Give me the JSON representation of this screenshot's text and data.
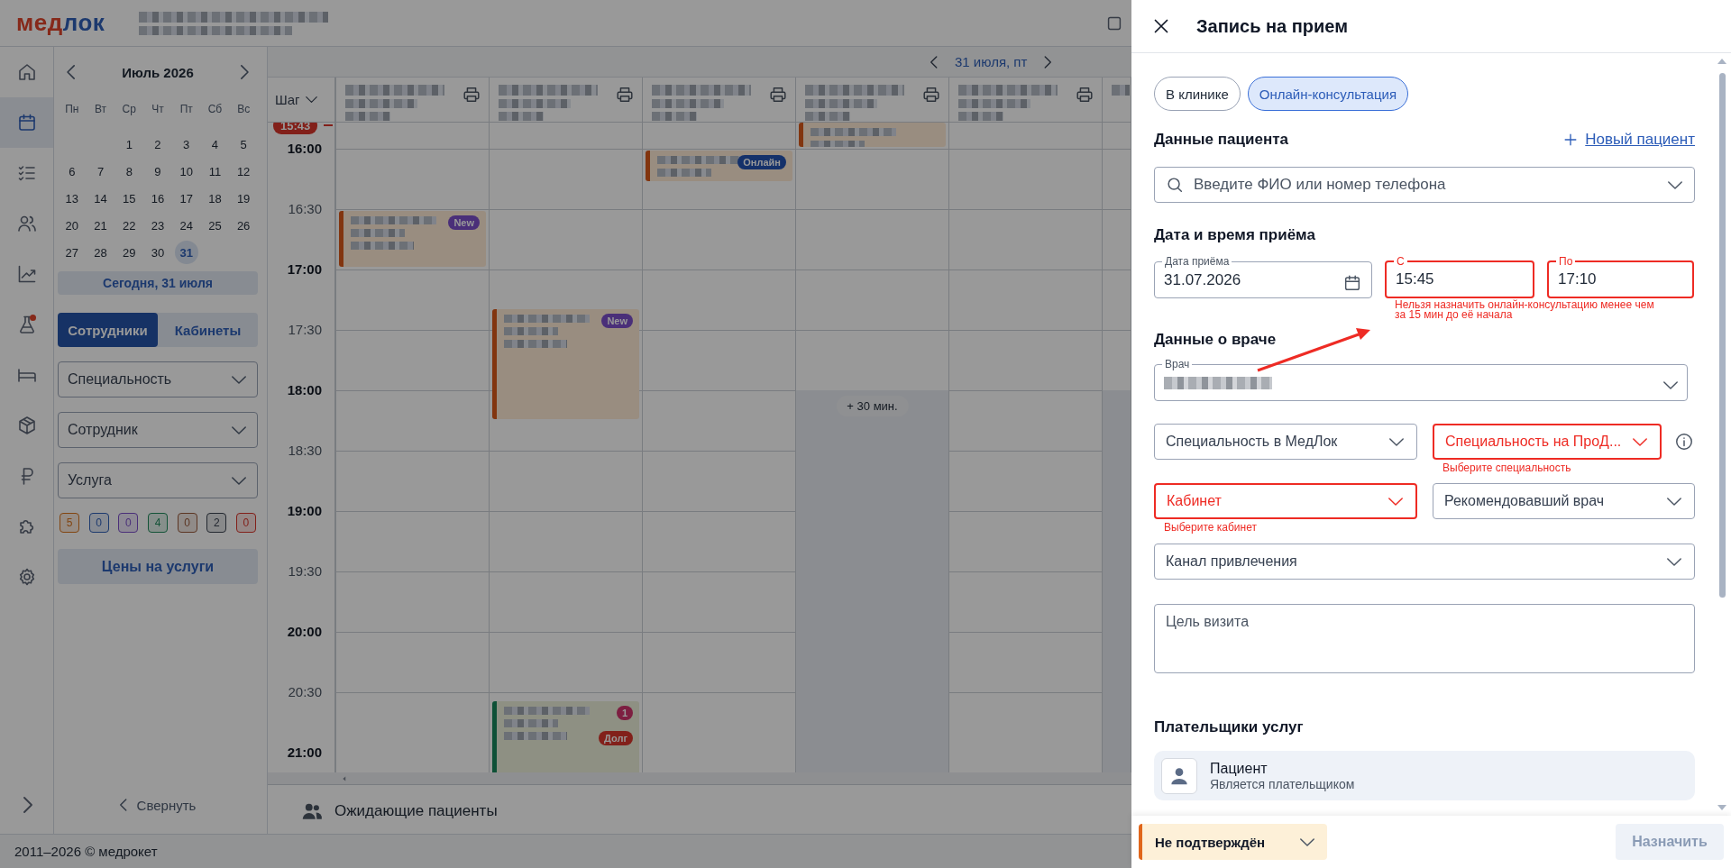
{
  "header": {
    "logo_red": "мед",
    "logo_blue": "лок"
  },
  "rail": {
    "items": [
      {
        "kind": "home",
        "selected": false,
        "dot": false
      },
      {
        "kind": "calendar",
        "selected": true,
        "dot": false
      },
      {
        "kind": "tasks",
        "selected": false,
        "dot": false
      },
      {
        "kind": "people",
        "selected": false,
        "dot": false
      },
      {
        "kind": "chart",
        "selected": false,
        "dot": false
      },
      {
        "kind": "flask",
        "selected": false,
        "dot": true
      },
      {
        "kind": "bed",
        "selected": false,
        "dot": false
      },
      {
        "kind": "box",
        "selected": false,
        "dot": false
      },
      {
        "kind": "ruble",
        "selected": false,
        "dot": false
      },
      {
        "kind": "puzzle",
        "selected": false,
        "dot": false
      },
      {
        "kind": "gear",
        "selected": false,
        "dot": false
      }
    ]
  },
  "calendar": {
    "month": "Июль 2026",
    "weekdays": [
      "Пн",
      "Вт",
      "Ср",
      "Чт",
      "Пт",
      "Сб",
      "Вс"
    ],
    "weeks": [
      {
        "days": [
          {
            "kind": "blank"
          },
          {
            "kind": "blank"
          },
          {
            "kind": "day",
            "day": "1",
            "selected": false
          },
          {
            "kind": "day",
            "day": "2",
            "selected": false
          },
          {
            "kind": "day",
            "day": "3",
            "selected": false
          },
          {
            "kind": "day",
            "day": "4",
            "selected": false
          },
          {
            "kind": "day",
            "day": "5",
            "selected": false
          }
        ]
      },
      {
        "days": [
          {
            "kind": "day",
            "day": "6",
            "selected": false
          },
          {
            "kind": "day",
            "day": "7",
            "selected": false
          },
          {
            "kind": "day",
            "day": "8",
            "selected": false
          },
          {
            "kind": "day",
            "day": "9",
            "selected": false
          },
          {
            "kind": "day",
            "day": "10",
            "selected": false
          },
          {
            "kind": "day",
            "day": "11",
            "selected": false
          },
          {
            "kind": "day",
            "day": "12",
            "selected": false
          }
        ]
      },
      {
        "days": [
          {
            "kind": "day",
            "day": "13",
            "selected": false
          },
          {
            "kind": "day",
            "day": "14",
            "selected": false
          },
          {
            "kind": "day",
            "day": "15",
            "selected": false
          },
          {
            "kind": "day",
            "day": "16",
            "selected": false
          },
          {
            "kind": "day",
            "day": "17",
            "selected": false
          },
          {
            "kind": "day",
            "day": "18",
            "selected": false
          },
          {
            "kind": "day",
            "day": "19",
            "selected": false
          }
        ]
      },
      {
        "days": [
          {
            "kind": "day",
            "day": "20",
            "selected": false
          },
          {
            "kind": "day",
            "day": "21",
            "selected": false
          },
          {
            "kind": "day",
            "day": "22",
            "selected": false
          },
          {
            "kind": "day",
            "day": "23",
            "selected": false
          },
          {
            "kind": "day",
            "day": "24",
            "selected": false
          },
          {
            "kind": "day",
            "day": "25",
            "selected": false
          },
          {
            "kind": "day",
            "day": "26",
            "selected": false
          }
        ]
      },
      {
        "days": [
          {
            "kind": "day",
            "day": "27",
            "selected": false
          },
          {
            "kind": "day",
            "day": "28",
            "selected": false
          },
          {
            "kind": "day",
            "day": "29",
            "selected": false
          },
          {
            "kind": "day",
            "day": "30",
            "selected": false
          },
          {
            "kind": "day",
            "day": "31",
            "selected": true
          }
        ]
      }
    ],
    "today_button": "Сегодня, 31 июля"
  },
  "side": {
    "view_tabs": [
      {
        "label": "Сотрудники",
        "selected": true
      },
      {
        "label": "Кабинеты",
        "selected": false
      }
    ],
    "filters": [
      {
        "placeholder": "Специальность"
      },
      {
        "placeholder": "Сотрудник"
      },
      {
        "placeholder": "Услуга"
      }
    ],
    "counters": [
      {
        "value": "5",
        "color": "#824510"
      },
      {
        "value": "0",
        "color": "#1c396e"
      },
      {
        "value": "0",
        "color": "#4a2f79"
      },
      {
        "value": "4",
        "color": "#135337"
      },
      {
        "value": "0",
        "color": "#5c3623"
      },
      {
        "value": "2",
        "color": "#232830"
      },
      {
        "value": "0",
        "color": "#82201a"
      }
    ],
    "prices_button": "Цены на услуги",
    "collapse": "Свернуть"
  },
  "schedule": {
    "date": "31 июля, пт",
    "step": "Шаг",
    "current_time": "15:43",
    "times": [
      {
        "label": "16:00",
        "emphasized": true
      },
      {
        "label": "16:30",
        "emphasized": false
      },
      {
        "label": "17:00",
        "emphasized": true
      },
      {
        "label": "17:30",
        "emphasized": false
      },
      {
        "label": "18:00",
        "emphasized": true
      },
      {
        "label": "18:30",
        "emphasized": false
      },
      {
        "label": "19:00",
        "emphasized": true
      },
      {
        "label": "19:30",
        "emphasized": false
      },
      {
        "label": "20:00",
        "emphasized": true
      },
      {
        "label": "20:30",
        "emphasized": false
      },
      {
        "label": "21:00",
        "emphasized": true
      }
    ],
    "columns": [
      {
        "cut_off": false,
        "slots": [
          {
            "kind": "free"
          },
          {
            "kind": "free"
          },
          {
            "kind": "normal",
            "color": "#82350f",
            "badges": [
              {
                "label": "New",
                "color": "#4a2f79"
              }
            ]
          }
        ]
      },
      {
        "cut_off": false,
        "slots": [
          {
            "kind": "free"
          },
          {
            "kind": "free"
          },
          {
            "kind": "free"
          },
          {
            "kind": "long",
            "color": "#82350f",
            "badges": [
              {
                "label": "New",
                "color": "#4a2f79"
              }
            ]
          },
          {
            "kind": "free"
          },
          {
            "kind": "free"
          },
          {
            "kind": "free"
          },
          {
            "kind": "free"
          },
          {
            "kind": "free"
          },
          {
            "kind": "free"
          },
          {
            "kind": "open",
            "color": "#0e5036",
            "badges": [
              {
                "label": "1",
                "color": "#7d1f41"
              },
              {
                "label": "Долг",
                "color": "#82201a"
              }
            ]
          }
        ]
      },
      {
        "cut_off": false,
        "slots": [
          {
            "kind": "free"
          },
          {
            "kind": "short",
            "color": "#82350f",
            "badges": [
              {
                "label": "Онлайн",
                "color": "#15316a"
              }
            ]
          }
        ]
      },
      {
        "cut_off": false,
        "slots": [
          {
            "kind": "tail",
            "color": "#82350f"
          },
          {
            "kind": "free"
          },
          {
            "kind": "free"
          },
          {
            "kind": "free"
          },
          {
            "kind": "free"
          },
          {
            "kind": "blocked",
            "extra_label": "+ 30 мин."
          },
          {
            "kind": "blocked"
          },
          {
            "kind": "blocked"
          },
          {
            "kind": "blocked"
          },
          {
            "kind": "blocked"
          },
          {
            "kind": "blocked"
          },
          {
            "kind": "blocked"
          }
        ]
      },
      {
        "cut_off": false
      },
      {
        "cut_off": true,
        "slots": [
          {
            "kind": "free"
          },
          {
            "kind": "free"
          },
          {
            "kind": "free"
          },
          {
            "kind": "free"
          },
          {
            "kind": "free"
          },
          {
            "kind": "blocked"
          },
          {
            "kind": "blocked"
          },
          {
            "kind": "blocked"
          },
          {
            "kind": "blocked"
          },
          {
            "kind": "blocked"
          },
          {
            "kind": "blocked"
          },
          {
            "kind": "blocked"
          }
        ]
      }
    ],
    "waiting": "Ожидающие пациенты"
  },
  "footer": "2011–2026 © медрокет",
  "drawer": {
    "title": "Запись на прием",
    "visit_types": [
      {
        "label": "В клинике",
        "selected": false
      },
      {
        "label": "Онлайн-консультация",
        "selected": true
      }
    ],
    "patient": {
      "title": "Данные пациента",
      "new_patient": "Новый пациент",
      "search_placeholder": "Введите ФИО или номер телефона"
    },
    "datetime": {
      "title": "Дата и время приёма",
      "date": {
        "label": "Дата приёма",
        "value": "31.07.2026"
      },
      "from": {
        "label": "С",
        "value": "15:45",
        "error": true
      },
      "to": {
        "label": "По",
        "value": "17:10",
        "error": true
      },
      "error_message": "Нельзя назначить онлайн-консультацию менее чем за 15 мин до её начала"
    },
    "doctor": {
      "title": "Данные о враче",
      "doctor_label": "Врач",
      "specialty_medlok": {
        "placeholder": "Специальность в МедЛок",
        "error": false
      },
      "specialty_prodoctorov": {
        "placeholder": "Специальность на ПроД...",
        "error": true,
        "error_message": "Выберите специальность"
      },
      "cabinet": {
        "placeholder": "Кабинет",
        "error": true,
        "error_message": "Выберите кабинет"
      },
      "referrer": {
        "placeholder": "Рекомендовавший врач",
        "error": false
      },
      "channel": {
        "placeholder": "Канал привлечения",
        "error": false
      },
      "purpose_placeholder": "Цель визита"
    },
    "payers": {
      "title": "Плательщики услуг",
      "items": [
        {
          "name": "Пациент",
          "note": "Является плательщиком"
        }
      ]
    },
    "status": "Не подтверждён",
    "assign": {
      "label": "Назначить",
      "disabled": true
    }
  }
}
